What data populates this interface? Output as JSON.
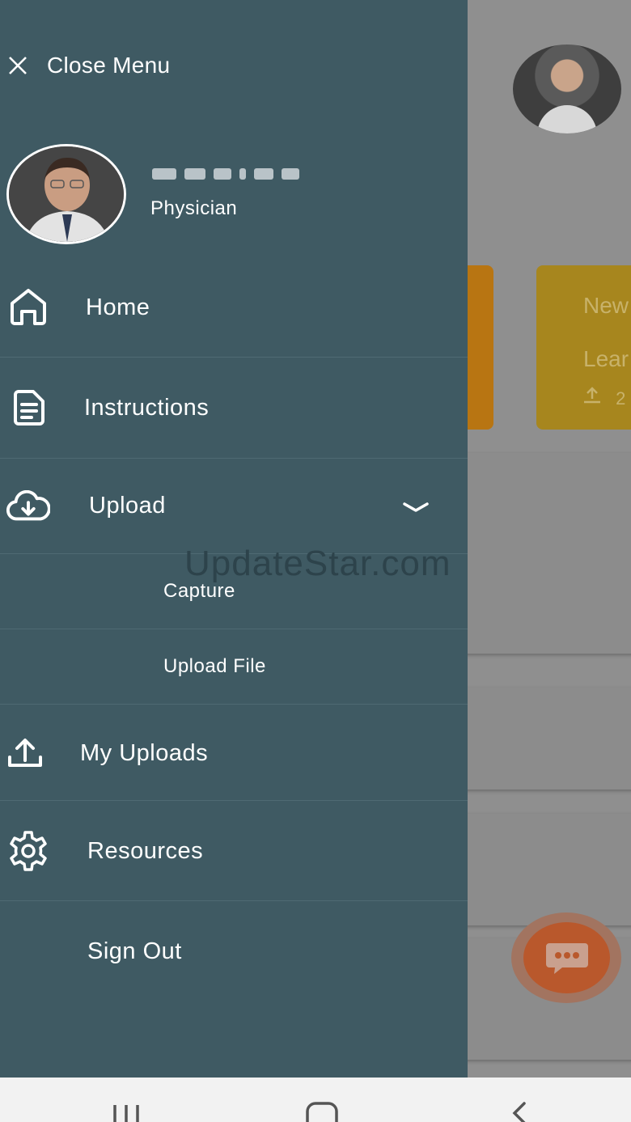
{
  "drawer": {
    "close_label": "Close Menu",
    "profile": {
      "name_redacted": "",
      "role": "Physician"
    },
    "items": [
      {
        "label": "Home",
        "icon": "home-icon"
      },
      {
        "label": "Instructions",
        "icon": "document-icon"
      },
      {
        "label": "Upload",
        "icon": "cloud-download-icon",
        "expanded": true
      },
      {
        "label": "Capture",
        "sub": true
      },
      {
        "label": "Upload File",
        "sub": true
      },
      {
        "label": "My Uploads",
        "icon": "upload-icon"
      },
      {
        "label": "Resources",
        "icon": "gear-icon"
      },
      {
        "label": "Sign Out"
      }
    ]
  },
  "background": {
    "card_title": "New",
    "card_subtitle": "Lear",
    "card_meta": "2"
  },
  "watermark": "UpdateStar.com",
  "colors": {
    "drawer_bg": "#3f5a63",
    "fab": "#b9582c"
  }
}
